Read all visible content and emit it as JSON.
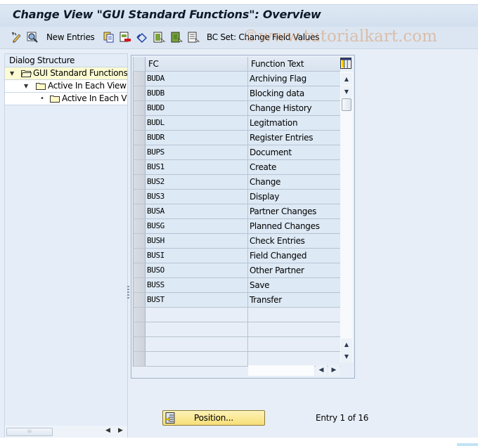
{
  "window": {
    "title": "Change View \"GUI Standard Functions\": Overview"
  },
  "toolbar": {
    "items": [
      {
        "icon": "display-change-icon"
      },
      {
        "icon": "details-icon"
      },
      {
        "label": "New Entries"
      },
      {
        "icon": "copy-as-icon"
      },
      {
        "icon": "delete-icon"
      },
      {
        "icon": "undo-change-icon"
      },
      {
        "icon": "select-all-icon"
      },
      {
        "icon": "select-block-icon"
      },
      {
        "icon": "deselect-all-icon"
      },
      {
        "label": "BC Set: Change Field Values"
      }
    ],
    "new_entries_label": "New Entries",
    "bc_set_label": "BC Set: Change Field Values",
    "watermark": "©www.tutorialkart.com"
  },
  "dialog_structure": {
    "header": "Dialog Structure",
    "nodes": [
      {
        "label": "GUI Standard Functions",
        "level": 0,
        "expanded": true,
        "selected": true
      },
      {
        "label": "Active In Each View",
        "level": 1,
        "expanded": true,
        "selected": false
      },
      {
        "label": "Active In Each View",
        "level": 2,
        "expanded": false,
        "selected": false
      }
    ]
  },
  "table": {
    "columns": [
      "FC",
      "Function Text"
    ],
    "rows": [
      {
        "fc": "BUDA",
        "text": "Archiving Flag"
      },
      {
        "fc": "BUDB",
        "text": "Blocking data"
      },
      {
        "fc": "BUDD",
        "text": "Change History"
      },
      {
        "fc": "BUDL",
        "text": "Legitmation"
      },
      {
        "fc": "BUDR",
        "text": "Register Entries"
      },
      {
        "fc": "BUPS",
        "text": "Document"
      },
      {
        "fc": "BUS1",
        "text": "Create"
      },
      {
        "fc": "BUS2",
        "text": "Change"
      },
      {
        "fc": "BUS3",
        "text": "Display"
      },
      {
        "fc": "BUSA",
        "text": "Partner Changes"
      },
      {
        "fc": "BUSG",
        "text": "Planned Changes"
      },
      {
        "fc": "BUSH",
        "text": "Check Entries"
      },
      {
        "fc": "BUSI",
        "text": "Field Changed"
      },
      {
        "fc": "BUSO",
        "text": "Other Partner"
      },
      {
        "fc": "BUSS",
        "text": "Save"
      },
      {
        "fc": "BUST",
        "text": "Transfer"
      }
    ],
    "empty_rows": 4
  },
  "footer": {
    "position_button": "Position...",
    "entry_info": "Entry 1 of 16"
  },
  "colors": {
    "selected_tree_bg": "#fdfbd1",
    "position_button_bg": "#f7de76",
    "row_bg": "#dde9f5"
  }
}
